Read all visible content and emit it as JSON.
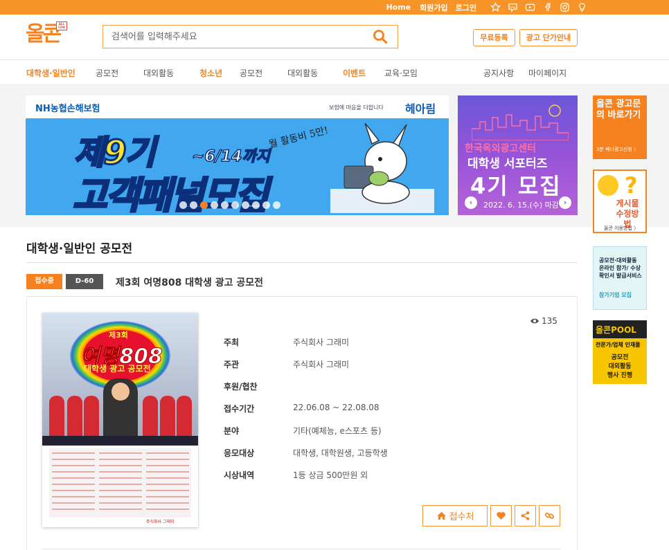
{
  "topbar": {
    "home": "Home",
    "signup": "회원가입",
    "login": "로그인",
    "icons": [
      "star-icon",
      "blog-icon",
      "youtube-icon",
      "facebook-icon",
      "instagram-icon",
      "lightbulb-icon"
    ]
  },
  "header": {
    "logo_text": "올콘",
    "logo_badge": "ALL CON",
    "search_placeholder": "검색어를 입력해주세요",
    "free_register": "무료등록",
    "ad_pricing": "광고 단가안내"
  },
  "nav": {
    "left": [
      {
        "label": "대학생·일반인",
        "highlight": true
      },
      {
        "label": "공모전",
        "highlight": false
      },
      {
        "label": "대외활동",
        "highlight": false
      },
      {
        "label": "청소년",
        "highlight": true
      },
      {
        "label": "공모전",
        "highlight": false
      },
      {
        "label": "대외활동",
        "highlight": false
      },
      {
        "label": "이벤트",
        "highlight": true
      },
      {
        "label": "교육·모임",
        "highlight": false
      }
    ],
    "right": [
      "공지사항",
      "마이페이지"
    ]
  },
  "banner_main": {
    "brand_left": "NH농협손해보험",
    "tagline": "보험에 마음을 더합니다",
    "brand_right": "헤아림",
    "title1": "제9기",
    "deadline": "~6/14까지",
    "title2": "고객패널모집",
    "hand": "월 활동비 5만!",
    "dots": 10,
    "active_dot": 2
  },
  "banner_side": {
    "line1": "한국옥외광고센터",
    "line2": "대학생 서포터즈",
    "line3": "4기 모집",
    "line4": "2022. 6. 15.(수) 마감"
  },
  "side_ads": {
    "ad1_title": "올콘 광고문의 바로가기",
    "ad1_sub": "3분 배너광고신청 〉",
    "ad2_title": "게시물 수정방법",
    "ad2_sub": "올콘 이용방법 〉",
    "ad3_title": "공모전·대외활동 온라인 참가/ 수상확인서 발급서비스",
    "ad3_sub": "참가기업 모집",
    "ad4_head": "올콘POOL",
    "ad4_sub": "전문가/업체 인재풀",
    "ad4_list": [
      "공모전",
      "대외활동",
      "행사 진행"
    ]
  },
  "section": {
    "title": "대학생·일반인 공모전",
    "status_badge": "접수중",
    "dday_badge": "D-60",
    "contest_title": "제3회 여명808 대학생 광고 공모전",
    "views": "135"
  },
  "poster": {
    "line1": "제3회",
    "line2": "여명808",
    "line3": "대학생 광고 공모전",
    "footer": "주식회사 그래미"
  },
  "details": [
    {
      "label": "주최",
      "value": "주식회사 그래미"
    },
    {
      "label": "주관",
      "value": "주식회사 그래미"
    },
    {
      "label": "후원/협찬",
      "value": ""
    },
    {
      "label": "접수기간",
      "value": "22.06.08 ~ 22.08.08"
    },
    {
      "label": "분야",
      "value": "기타(예체능, e스포츠 등)"
    },
    {
      "label": "응모대상",
      "value": "대학생, 대학원생, 고등학생"
    },
    {
      "label": "시상내역",
      "value": "1등 상금 500만원 외"
    }
  ],
  "actions": {
    "go_label": "접수처"
  },
  "colors": {
    "accent": "#f5821f",
    "topbar": "#f79428",
    "dark_badge": "#555555"
  }
}
